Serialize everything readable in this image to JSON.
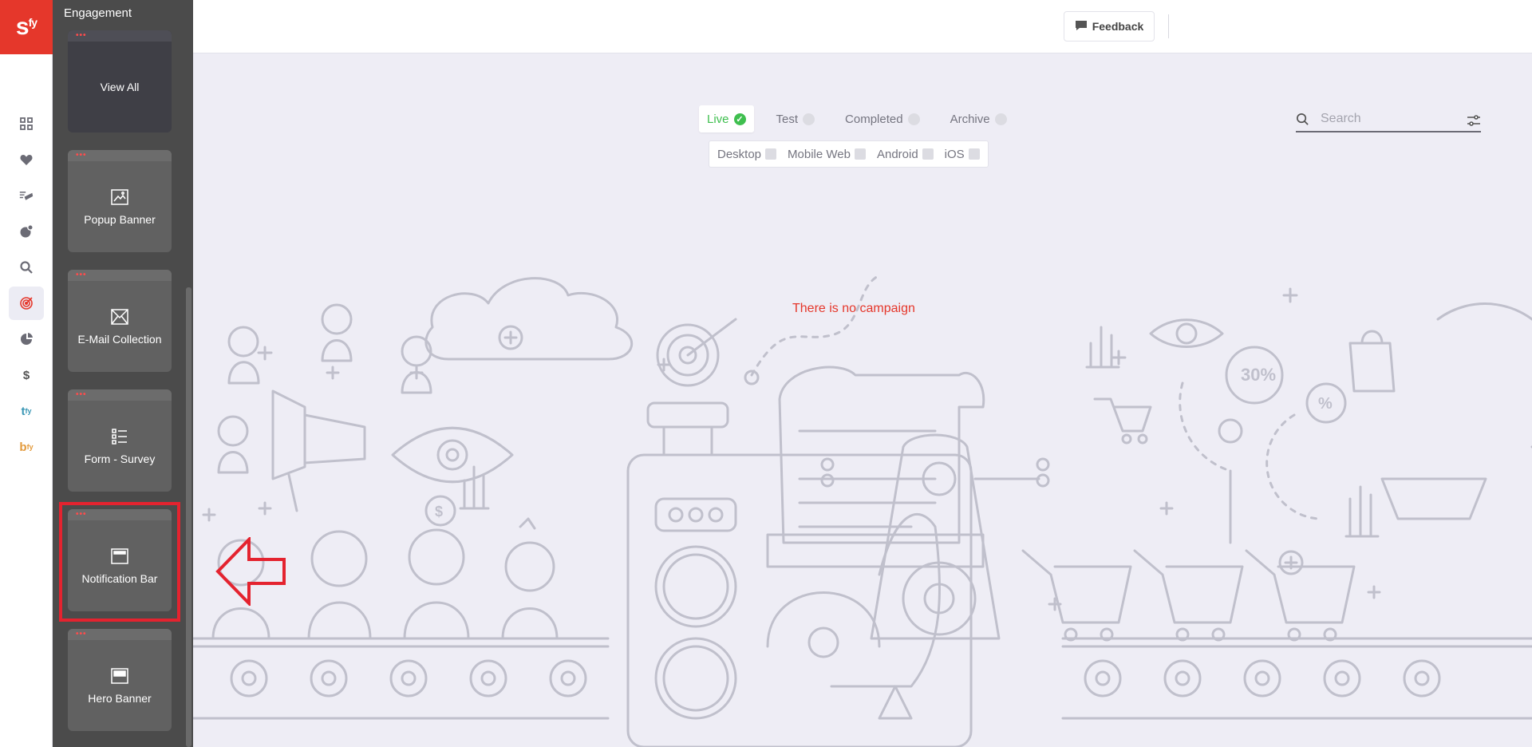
{
  "brand": {
    "logo_text": "s",
    "logo_sup": "fy",
    "color": "#e5372b"
  },
  "rail": {
    "items": [
      {
        "icon": "grid-icon"
      },
      {
        "icon": "heart-icon"
      },
      {
        "icon": "campaign-icon"
      },
      {
        "icon": "segments-icon"
      },
      {
        "icon": "search-icon"
      },
      {
        "icon": "target-icon",
        "active": true
      },
      {
        "icon": "pie-chart-icon"
      },
      {
        "icon": "dollar-icon"
      },
      {
        "text": "t",
        "sup": "fy",
        "color": "#3a97b5"
      },
      {
        "text": "b",
        "sup": "fy",
        "color": "#e39a3b"
      }
    ],
    "dollar_glyph": "$"
  },
  "panel": {
    "title": "Engagement",
    "cards": [
      {
        "label": "View All",
        "icon": ""
      },
      {
        "label": "Popup Banner",
        "icon": "image-icon"
      },
      {
        "label": "E-Mail Collection",
        "icon": "email-icon"
      },
      {
        "label": "Form - Survey",
        "icon": "list-icon"
      },
      {
        "label": "Notification Bar",
        "icon": "notification-bar-icon",
        "highlighted": true
      },
      {
        "label": "Hero Banner",
        "icon": "hero-banner-icon"
      }
    ],
    "card_dots": "•••"
  },
  "topbar": {
    "feedback_label": "Feedback"
  },
  "status_tabs": [
    {
      "label": "Live",
      "active": true
    },
    {
      "label": "Test"
    },
    {
      "label": "Completed"
    },
    {
      "label": "Archive"
    }
  ],
  "platforms": [
    {
      "label": "Desktop"
    },
    {
      "label": "Mobile Web"
    },
    {
      "label": "Android"
    },
    {
      "label": "iOS"
    }
  ],
  "search": {
    "placeholder": "Search",
    "value": ""
  },
  "empty_message": "There is no campaign",
  "illustration_labels": {
    "percent_badge": "30%",
    "percent_symbol": "%",
    "dollar": "$"
  },
  "colors": {
    "live_green": "#3fbf4f",
    "highlight_red": "#e4232f",
    "illustration_stroke": "#c0c0cc"
  }
}
